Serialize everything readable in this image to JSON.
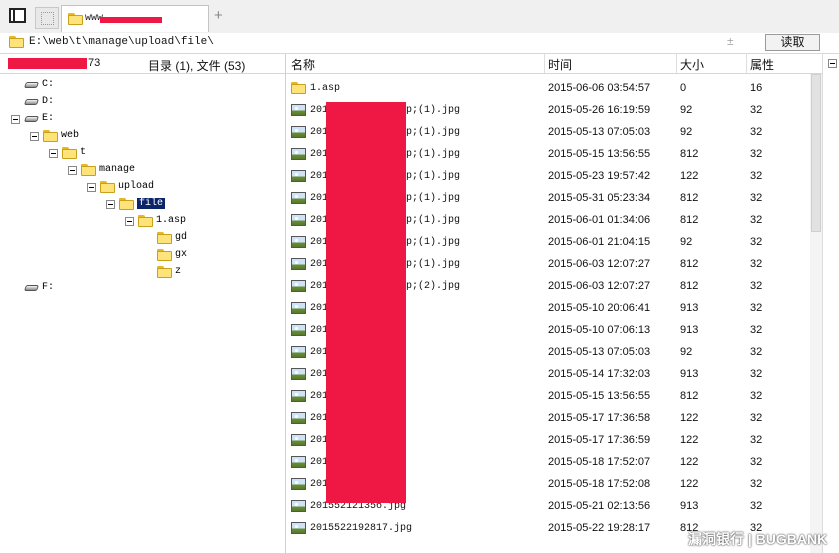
{
  "tabs": [
    {
      "title": "www"
    }
  ],
  "toolbar": {
    "new_tab_symbol": "+"
  },
  "path": {
    "value": "E:\\web\\t\\manage\\upload\\file\\",
    "read_button": "读取",
    "dropdown_symbol": "±"
  },
  "left_header": {
    "count": "73",
    "summary": "目录 (1), 文件 (53)"
  },
  "tree": [
    {
      "label": "C:",
      "type": "drive",
      "indent": 0
    },
    {
      "label": "D:",
      "type": "drive",
      "indent": 0
    },
    {
      "label": "E:",
      "type": "drive",
      "indent": 0,
      "expanded": true
    },
    {
      "label": "web",
      "type": "folder",
      "indent": 1,
      "expanded": true
    },
    {
      "label": "t",
      "type": "folder",
      "indent": 2,
      "expanded": true
    },
    {
      "label": "manage",
      "type": "folder",
      "indent": 3,
      "expanded": true
    },
    {
      "label": "upload",
      "type": "folder",
      "indent": 4,
      "expanded": true
    },
    {
      "label": "file",
      "type": "folder",
      "indent": 5,
      "expanded": true,
      "selected": true
    },
    {
      "label": "1.asp",
      "type": "folder",
      "indent": 6,
      "expanded": true
    },
    {
      "label": "gd",
      "type": "folder",
      "indent": 7
    },
    {
      "label": "gx",
      "type": "folder",
      "indent": 7
    },
    {
      "label": "z",
      "type": "folder",
      "indent": 7
    },
    {
      "label": "F:",
      "type": "drive",
      "indent": 0,
      "gap": true
    }
  ],
  "columns": {
    "name": "名称",
    "time": "时间",
    "size": "大小",
    "attr": "属性"
  },
  "files": [
    {
      "name": "1.asp",
      "type": "folder",
      "time": "2015-06-06 03:54:57",
      "size": "0",
      "attr": "16"
    },
    {
      "name": "201            sp;(1).jpg",
      "type": "image",
      "time": "2015-05-26 16:19:59",
      "size": "92",
      "attr": "32"
    },
    {
      "name": "201            sp;(1).jpg",
      "type": "image",
      "time": "2015-05-13 07:05:03",
      "size": "92",
      "attr": "32"
    },
    {
      "name": "201            sp;(1).jpg",
      "type": "image",
      "time": "2015-05-15 13:56:55",
      "size": "812",
      "attr": "32"
    },
    {
      "name": "201            sp;(1).jpg",
      "type": "image",
      "time": "2015-05-23 19:57:42",
      "size": "122",
      "attr": "32"
    },
    {
      "name": "201            sp;(1).jpg",
      "type": "image",
      "time": "2015-05-31 05:23:34",
      "size": "812",
      "attr": "32"
    },
    {
      "name": "201            sp;(1).jpg",
      "type": "image",
      "time": "2015-06-01 01:34:06",
      "size": "812",
      "attr": "32"
    },
    {
      "name": "201            sp;(1).jpg",
      "type": "image",
      "time": "2015-06-01 21:04:15",
      "size": "92",
      "attr": "32"
    },
    {
      "name": "201            sp;(1).jpg",
      "type": "image",
      "time": "2015-06-03 12:07:27",
      "size": "812",
      "attr": "32"
    },
    {
      "name": "201            sp;(2).jpg",
      "type": "image",
      "time": "2015-06-03 12:07:27",
      "size": "812",
      "attr": "32"
    },
    {
      "name": "201            g",
      "type": "image",
      "time": "2015-05-10 20:06:41",
      "size": "913",
      "attr": "32"
    },
    {
      "name": "201",
      "type": "image",
      "time": "2015-05-10 07:06:13",
      "size": "913",
      "attr": "32"
    },
    {
      "name": "201",
      "type": "image",
      "time": "2015-05-13 07:05:03",
      "size": "92",
      "attr": "32"
    },
    {
      "name": "201            g",
      "type": "image",
      "time": "2015-05-14 17:32:03",
      "size": "913",
      "attr": "32"
    },
    {
      "name": "201            g",
      "type": "image",
      "time": "2015-05-15 13:56:55",
      "size": "812",
      "attr": "32"
    },
    {
      "name": "201            g",
      "type": "image",
      "time": "2015-05-17 17:36:58",
      "size": "122",
      "attr": "32"
    },
    {
      "name": "201            g",
      "type": "image",
      "time": "2015-05-17 17:36:59",
      "size": "122",
      "attr": "32"
    },
    {
      "name": "201            g",
      "type": "image",
      "time": "2015-05-18 17:52:07",
      "size": "122",
      "attr": "32"
    },
    {
      "name": "201            g",
      "type": "image",
      "time": "2015-05-18 17:52:08",
      "size": "122",
      "attr": "32"
    },
    {
      "name": "20155212135б.jpg",
      "type": "image",
      "time": "2015-05-21 02:13:56",
      "size": "913",
      "attr": "32"
    },
    {
      "name": "2015522192817.jpg",
      "type": "image",
      "time": "2015-05-22 19:28:17",
      "size": "812",
      "attr": "32"
    }
  ],
  "watermark": "漏洞银行 | BUGBANK",
  "colors": {
    "redaction": "#ef1844",
    "selection": "#0b246a",
    "folder": "#fde37a"
  }
}
